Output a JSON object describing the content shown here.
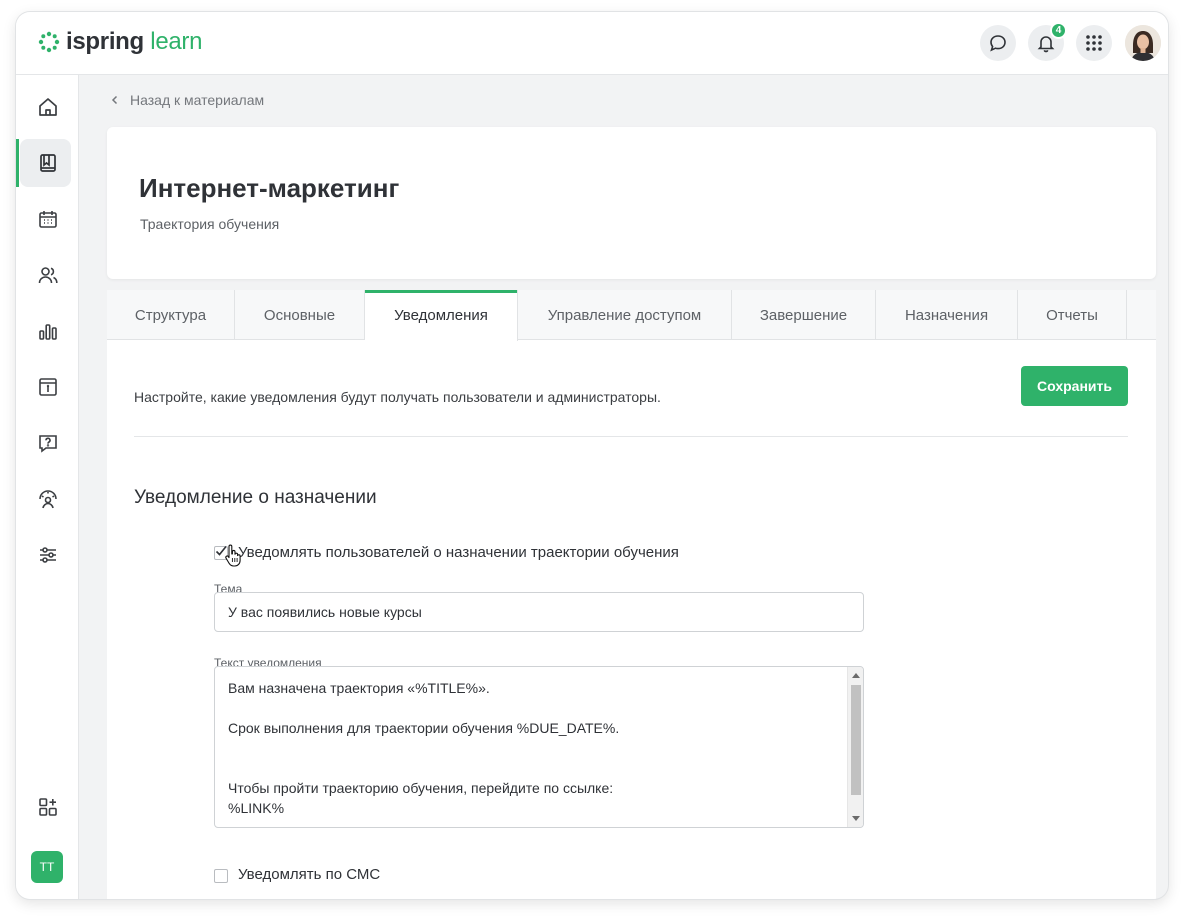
{
  "header": {
    "logo_word1": "ispring",
    "logo_word2": "learn",
    "notifications_count": "4",
    "icons": [
      "chat-icon",
      "bell-icon",
      "apps-grid-icon"
    ],
    "brand_color": "#2fb26a"
  },
  "sidebar": {
    "items": [
      {
        "name": "home-icon"
      },
      {
        "name": "book-icon",
        "active": true
      },
      {
        "name": "calendar-icon"
      },
      {
        "name": "users-icon"
      },
      {
        "name": "bar-chart-icon"
      },
      {
        "name": "info-card-icon"
      },
      {
        "name": "question-icon"
      },
      {
        "name": "support-icon"
      },
      {
        "name": "settings-sliders-icon"
      },
      {
        "name": "add-widget-icon"
      }
    ],
    "user_initials": "TT"
  },
  "back_link": "Назад к материалам",
  "hero": {
    "title": "Интернет-маркетинг",
    "subtitle": "Траектория обучения"
  },
  "tabs": [
    {
      "label": "Структура"
    },
    {
      "label": "Основные"
    },
    {
      "label": "Уведомления",
      "active": true
    },
    {
      "label": "Управление доступом"
    },
    {
      "label": "Завершение"
    },
    {
      "label": "Назначения"
    },
    {
      "label": "Отчеты"
    }
  ],
  "content": {
    "description": "Настройте, какие уведомления будут получать пользователи и администраторы.",
    "save_label": "Сохранить",
    "section_title": "Уведомление о назначении",
    "notify_users_label": "Уведомлять пользователей о назначении траектории обучения",
    "notify_users_checked": true,
    "subject_label": "Тема",
    "subject_value": "У вас появились новые курсы",
    "body_label": "Текст уведомления",
    "body_lines": [
      "Вам назначена траектория «%TITLE%».",
      "Срок выполнения для траектории обучения %DUE_DATE%.",
      "Чтобы пройти траекторию обучения, перейдите по ссылке:",
      "%LINK%"
    ],
    "sms_label": "Уведомлять по СМС",
    "sms_checked": false
  }
}
